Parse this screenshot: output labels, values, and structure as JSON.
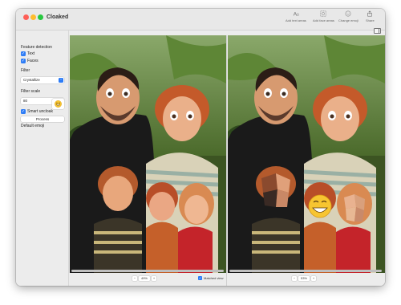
{
  "window": {
    "title": "Cloaked"
  },
  "toolbar": {
    "add_text_areas": "Add text areas",
    "add_face_areas": "Add face areas",
    "change_emoji": "Change emoji",
    "share": "Share"
  },
  "sidebar": {
    "feature_detection_label": "Feature detection",
    "text_label": "Text",
    "text_checked": true,
    "faces_label": "Faces",
    "faces_checked": true,
    "filter_label": "Filter",
    "filter_value": "Crystallize",
    "filter_scale_label": "Filter scale",
    "filter_scale_value": "80",
    "smart_uncloak_label": "Smart uncloak",
    "smart_uncloak_checked": true,
    "default_emoji_label": "Default emoji",
    "default_emoji_icon": "grinning-face-icon",
    "process_label": "Process"
  },
  "left_pane": {
    "zoom": "49%",
    "matched_view_label": "Matched view",
    "matched_view_checked": true
  },
  "right_pane": {
    "zoom": "53%"
  },
  "colors": {
    "accent": "#2d7cf6",
    "close": "#fe5f57",
    "minimize": "#febc2e",
    "maximize": "#28c840"
  }
}
